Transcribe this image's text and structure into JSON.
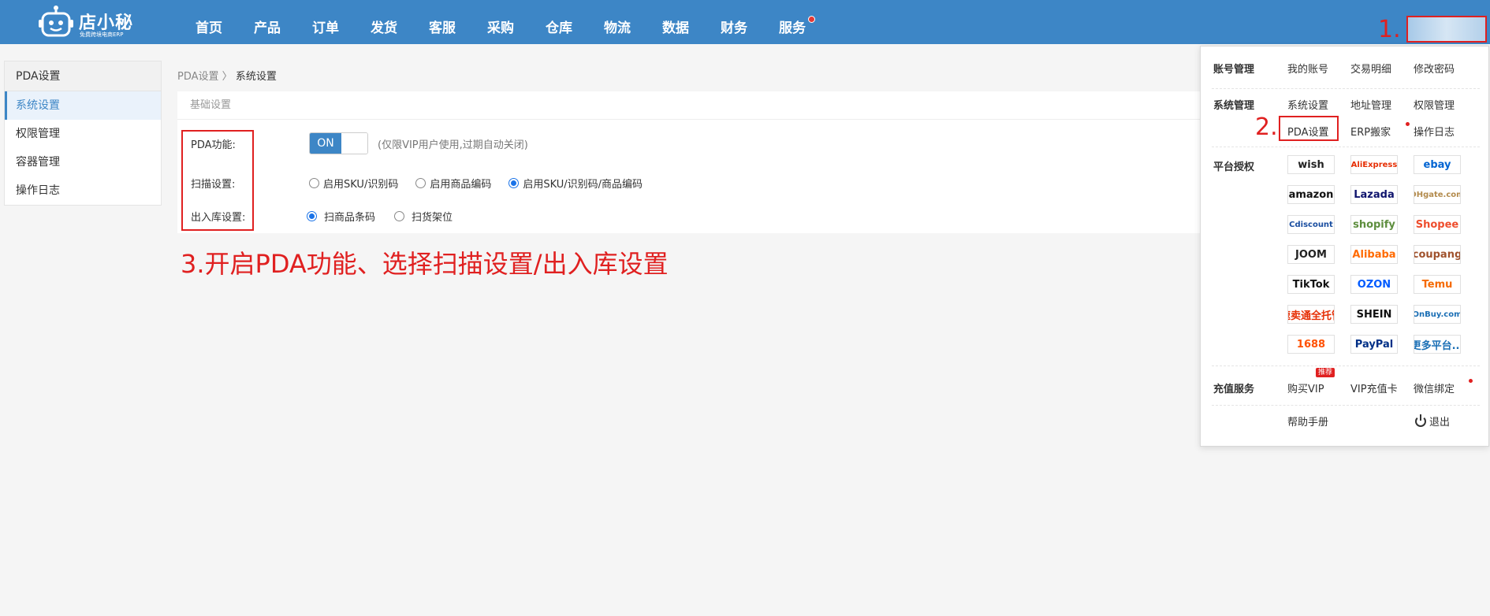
{
  "app": {
    "logo_text": "店小秘",
    "logo_sub": "免费跨境电商ERP"
  },
  "nav": {
    "items": [
      {
        "label": "首页"
      },
      {
        "label": "产品"
      },
      {
        "label": "订单"
      },
      {
        "label": "发货"
      },
      {
        "label": "客服"
      },
      {
        "label": "采购"
      },
      {
        "label": "仓库"
      },
      {
        "label": "物流"
      },
      {
        "label": "数据"
      },
      {
        "label": "财务"
      },
      {
        "label": "服务",
        "dot": true
      }
    ]
  },
  "annotations": {
    "step1": "1.",
    "step2": "2.",
    "step3": "3.开启PDA功能、选择扫描设置/出入库设置"
  },
  "sidebar": {
    "title": "PDA设置",
    "items": [
      {
        "label": "系统设置",
        "active": true
      },
      {
        "label": "权限管理"
      },
      {
        "label": "容器管理"
      },
      {
        "label": "操作日志"
      }
    ]
  },
  "breadcrumb": {
    "parent": "PDA设置",
    "separator": "〉",
    "current": "系统设置"
  },
  "panel": {
    "title": "基础设置",
    "pda": {
      "label": "PDA功能:",
      "toggle": "ON",
      "hint": "(仅限VIP用户使用,过期自动关闭)"
    },
    "scan": {
      "label": "扫描设置:",
      "options": [
        "启用SKU/识别码",
        "启用商品编码",
        "启用SKU/识别码/商品编码"
      ],
      "selected": 2
    },
    "inout": {
      "label": "出入库设置:",
      "options": [
        "扫商品条码",
        "扫货架位"
      ],
      "selected": 0
    }
  },
  "dropdown": {
    "account": {
      "title": "账号管理",
      "links": [
        "我的账号",
        "交易明细",
        "修改密码"
      ]
    },
    "system": {
      "title": "系统管理",
      "row1": [
        "系统设置",
        "地址管理",
        "权限管理"
      ],
      "row2": [
        "PDA设置",
        "ERP搬家",
        "操作日志"
      ]
    },
    "platform": {
      "title": "平台授权",
      "logos": [
        {
          "label": "wish",
          "color": "#222222"
        },
        {
          "label": "AliExpress",
          "color": "#e62e04"
        },
        {
          "label": "ebay",
          "color": "#0064d2"
        },
        {
          "label": "amazon",
          "color": "#111111"
        },
        {
          "label": "Lazada",
          "color": "#0f146d"
        },
        {
          "label": "DHgate.com",
          "color": "#b38b4d"
        },
        {
          "label": "Cdiscount",
          "color": "#1a4ea0"
        },
        {
          "label": "shopify",
          "color": "#5e8e3e"
        },
        {
          "label": "Shopee",
          "color": "#ee4d2d"
        },
        {
          "label": "JOOM",
          "color": "#222222"
        },
        {
          "label": "Alibaba",
          "color": "#ff6a00"
        },
        {
          "label": "coupang",
          "color": "#a0522d"
        },
        {
          "label": "TikTok",
          "color": "#111111"
        },
        {
          "label": "OZON",
          "color": "#005bff"
        },
        {
          "label": "Temu",
          "color": "#f56a00"
        },
        {
          "label": "速卖通全托管",
          "color": "#e62e04"
        },
        {
          "label": "SHEIN",
          "color": "#111111"
        },
        {
          "label": "OnBuy.com",
          "color": "#1b6fb5"
        },
        {
          "label": "1688",
          "color": "#ff5000"
        },
        {
          "label": "PayPal",
          "color": "#003087"
        },
        {
          "label": "更多平台...",
          "color": "#1b6fb5"
        }
      ]
    },
    "recharge": {
      "title": "充值服务",
      "links": [
        "购买VIP",
        "VIP充值卡",
        "微信绑定"
      ],
      "badge": "推荐"
    },
    "footer": {
      "help": "帮助手册",
      "logout": "退出"
    }
  }
}
